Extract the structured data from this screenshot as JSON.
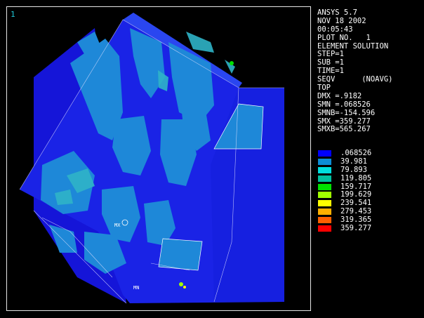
{
  "window_number": "1",
  "header": [
    "ANSYS 5.7",
    "NOV 18 2002",
    "00:05:43",
    "PLOT NO.   1",
    "ELEMENT SOLUTION",
    "STEP=1",
    "SUB =1",
    "TIME=1",
    "SEQV      (NOAVG)",
    "TOP",
    "DMX =.9182",
    "SMN =.068526",
    "SMNB=-154.596",
    "SMX =359.277",
    "SMXB=565.267"
  ],
  "legend": [
    {
      "value": ".068526",
      "color": "#0000ff"
    },
    {
      "value": "39.981",
      "color": "#0c8cd6"
    },
    {
      "value": "79.893",
      "color": "#00dede"
    },
    {
      "value": "119.805",
      "color": "#00c0a0"
    },
    {
      "value": "159.717",
      "color": "#00e000"
    },
    {
      "value": "199.629",
      "color": "#a0ff00"
    },
    {
      "value": "239.541",
      "color": "#ffff00"
    },
    {
      "value": "279.453",
      "color": "#ffb000"
    },
    {
      "value": "319.365",
      "color": "#ff6000"
    },
    {
      "value": "359.277",
      "color": "#ff0000"
    }
  ],
  "markers": {
    "mx": "MX",
    "mn": "MN"
  },
  "colors": {
    "background": "#000000",
    "frame": "#e6e6e6",
    "model_base": "#1a23e6",
    "model_contour": "#1e88d8"
  }
}
